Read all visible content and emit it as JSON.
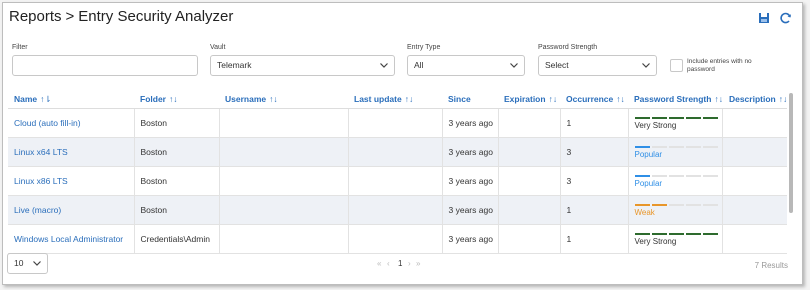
{
  "header": {
    "root": "Reports",
    "separator": ">",
    "title": "Entry Security Analyzer",
    "icons": [
      "save-icon",
      "refresh-icon"
    ]
  },
  "filters": {
    "filter": {
      "label": "Filter",
      "value": ""
    },
    "vault": {
      "label": "Vault",
      "value": "Telemark"
    },
    "entry_type": {
      "label": "Entry Type",
      "value": "All"
    },
    "password_strength": {
      "label": "Password Strength",
      "value": "Select"
    },
    "include_no_password": {
      "line1": "Include entries with no",
      "line2": "password",
      "checked": false
    }
  },
  "table": {
    "columns": [
      "Name",
      "Folder",
      "Username",
      "Last update",
      "Since",
      "Expiration",
      "Occurrence",
      "Password Strength",
      "Description"
    ],
    "rows": [
      {
        "name": "Cloud (auto fill-in)",
        "folder": "Boston",
        "username": "",
        "last_update": "",
        "since": "3 years ago",
        "expiration": "",
        "occurrence": "1",
        "strength": "Very Strong",
        "strength_level": 5,
        "strength_color": "#2e6b2e",
        "description": ""
      },
      {
        "name": "Linux x64 LTS",
        "folder": "Boston",
        "username": "",
        "last_update": "",
        "since": "3 years ago",
        "expiration": "",
        "occurrence": "3",
        "strength": "Popular",
        "strength_level": 1,
        "strength_color": "#2f8fe6",
        "description": ""
      },
      {
        "name": "Linux x86 LTS",
        "folder": "Boston",
        "username": "",
        "last_update": "",
        "since": "3 years ago",
        "expiration": "",
        "occurrence": "3",
        "strength": "Popular",
        "strength_level": 1,
        "strength_color": "#2f8fe6",
        "description": ""
      },
      {
        "name": "Live (macro)",
        "folder": "Boston",
        "username": "",
        "last_update": "",
        "since": "3 years ago",
        "expiration": "",
        "occurrence": "1",
        "strength": "Weak",
        "strength_level": 2,
        "strength_color": "#e8962a",
        "description": ""
      },
      {
        "name": "Windows Local Administrator",
        "folder": "Credentials\\Admin",
        "username": "",
        "last_update": "",
        "since": "3 years ago",
        "expiration": "",
        "occurrence": "1",
        "strength": "Very Strong",
        "strength_level": 5,
        "strength_color": "#2e6b2e",
        "description": ""
      }
    ]
  },
  "footer": {
    "page_size": "10",
    "nav_first": "«",
    "nav_prev": "‹",
    "current_page": "1",
    "nav_next": "›",
    "nav_last": "»",
    "results": "7 Results"
  }
}
